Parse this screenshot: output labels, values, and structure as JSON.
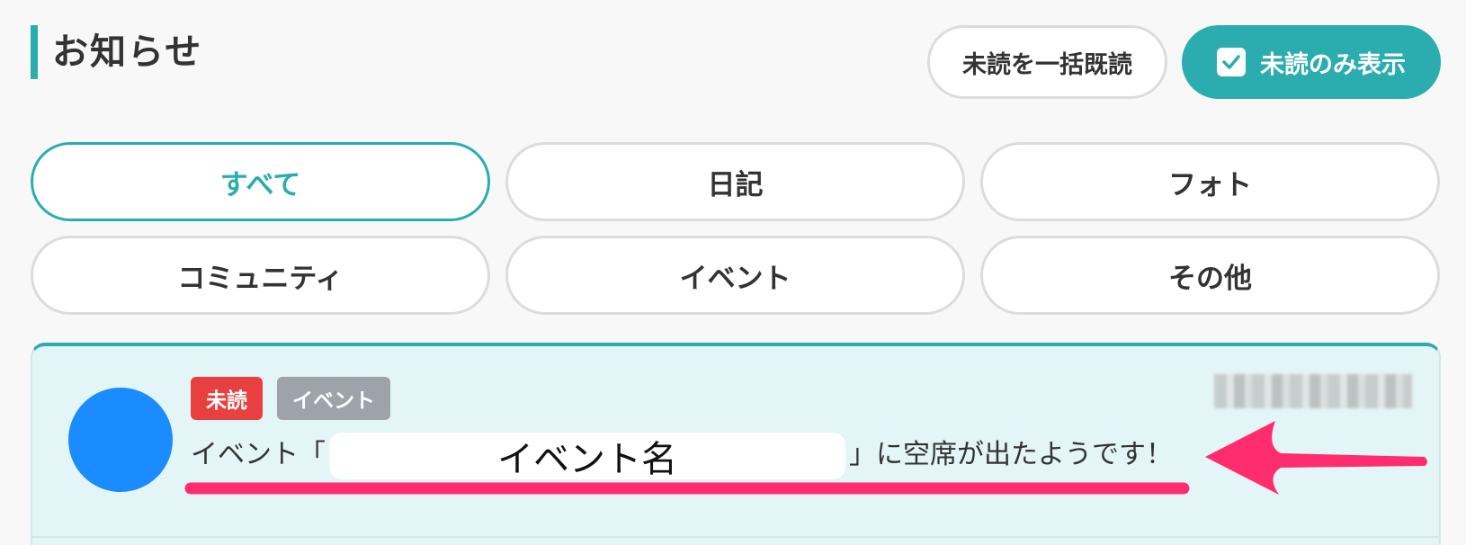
{
  "header": {
    "title": "お知らせ",
    "mark_all_read_label": "未読を一括既読",
    "unread_only_label": "未読のみ表示",
    "unread_only_checked": true
  },
  "tabs": [
    {
      "label": "すべて",
      "active": true
    },
    {
      "label": "日記",
      "active": false
    },
    {
      "label": "フォト",
      "active": false
    },
    {
      "label": "コミュニティ",
      "active": false
    },
    {
      "label": "イベント",
      "active": false
    },
    {
      "label": "その他",
      "active": false
    }
  ],
  "notification": {
    "badge_unread": "未読",
    "badge_category": "イベント",
    "message_prefix": "イベント「",
    "event_name": "イベント名",
    "message_suffix": "」に空席が出たようです！"
  },
  "colors": {
    "accent": "#2badb0",
    "unread_badge": "#e84040",
    "category_badge": "#9ea2ab",
    "avatar": "#1a8cff",
    "annotation": "#ff2d6f"
  }
}
